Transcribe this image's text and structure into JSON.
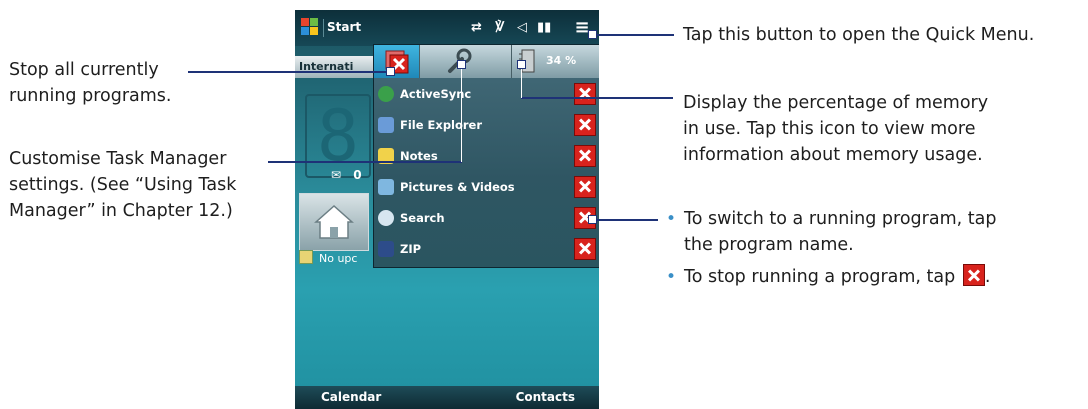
{
  "annotations": {
    "quick_menu": "Tap this button to open the Quick Menu.",
    "stop_all": [
      "Stop all currently",
      "running programs."
    ],
    "customise": [
      "Customise Task Manager",
      "settings. (See “Using Task",
      "Manager” in Chapter 12.)"
    ],
    "memory": [
      "Display the percentage of memory",
      "in use. Tap this icon to view more",
      "information about memory usage."
    ],
    "bullets": {
      "switch": [
        "To switch to a running program, tap",
        "the program name."
      ],
      "stop": "To stop running a program, tap",
      "stop_suffix": "."
    }
  },
  "phone": {
    "title": "Start",
    "home_tab": "Internati",
    "clock_digit": "8",
    "message_count": "0",
    "no_upcoming": "No upc",
    "quick_menu": {
      "memory_percent": "34 %",
      "programs": [
        {
          "name": "ActiveSync",
          "icon": "activesync-icon",
          "color": "#3aa04a"
        },
        {
          "name": "File Explorer",
          "icon": "file-explorer-icon",
          "color": "#6a9bd8"
        },
        {
          "name": "Notes",
          "icon": "notes-icon",
          "color": "#f1d24a"
        },
        {
          "name": "Pictures & Videos",
          "icon": "pictures-icon",
          "color": "#7fb7e0"
        },
        {
          "name": "Search",
          "icon": "search-icon",
          "color": "#d7e6f0"
        },
        {
          "name": "ZIP",
          "icon": "zip-icon",
          "color": "#2d4c8a"
        }
      ]
    },
    "softkeys": {
      "left": "Calendar",
      "right": "Contacts"
    }
  },
  "colors": {
    "leader_line": "#1e3277",
    "close_red": "#d8231d",
    "bullet": "#3a8fc7"
  }
}
